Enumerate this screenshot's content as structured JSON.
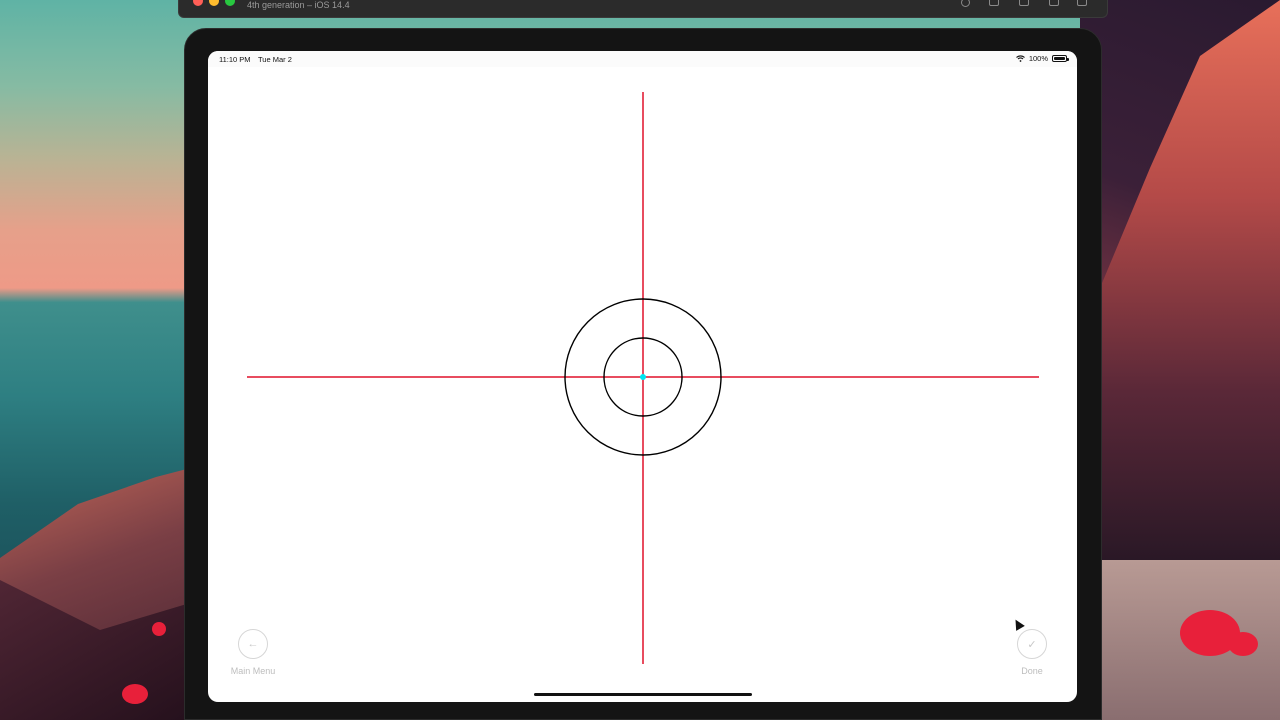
{
  "simulator": {
    "title": "4th generation – iOS 14.4",
    "traffic_light_colors": {
      "close": "#ff5f57",
      "minimize": "#febc2e",
      "zoom": "#28c840"
    }
  },
  "status_bar": {
    "time": "11:10 PM",
    "date": "Tue Mar 2",
    "wifi_icon": "wifi-icon",
    "battery_percent": "100%",
    "battery_level": 1.0
  },
  "crosshair": {
    "line_color": "#e0102a",
    "circle_color": "#000000",
    "center_dot_color": "#00e5f0"
  },
  "buttons": {
    "main_menu": {
      "label": "Main Menu",
      "icon": "arrow-left-icon",
      "glyph": "←"
    },
    "done": {
      "label": "Done",
      "icon": "checkmark-icon",
      "glyph": "✓"
    }
  }
}
